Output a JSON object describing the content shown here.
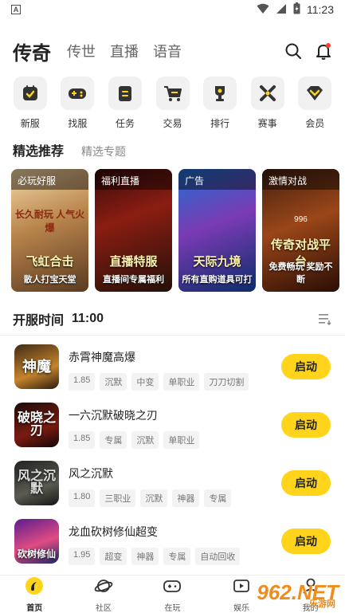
{
  "status_bar": {
    "time": "11:23",
    "app_indicator": "A"
  },
  "top_nav": {
    "tabs": [
      {
        "label": "传奇",
        "active": true
      },
      {
        "label": "传世",
        "active": false
      },
      {
        "label": "直播",
        "active": false
      },
      {
        "label": "语音",
        "active": false
      }
    ]
  },
  "quick_menu": [
    {
      "label": "新服",
      "icon": "calendar-check-icon"
    },
    {
      "label": "找服",
      "icon": "gamepad-icon"
    },
    {
      "label": "任务",
      "icon": "task-list-icon"
    },
    {
      "label": "交易",
      "icon": "cart-icon"
    },
    {
      "label": "排行",
      "icon": "trophy-icon"
    },
    {
      "label": "赛事",
      "icon": "crossed-swords-icon"
    },
    {
      "label": "会员",
      "icon": "vip-diamond-icon"
    }
  ],
  "section": {
    "title": "精选推荐",
    "subtitle": "精选专题"
  },
  "banners": [
    {
      "tag": "必玩好服",
      "big": "飞虹合击",
      "small": "散人打宝天堂",
      "top": "长久耐玩 人气火爆"
    },
    {
      "tag": "福利直播",
      "big": "直播特服",
      "small": "直播间专属福利",
      "top": ""
    },
    {
      "tag": "广告",
      "big": "天际九境",
      "small": "所有直购道具可打",
      "top": ""
    },
    {
      "tag": "激情对战",
      "big": "传奇对战平台",
      "small": "免费畅玩 奖励不断",
      "top": "996"
    }
  ],
  "open_time": {
    "label": "开服时间",
    "time": "11:00"
  },
  "servers": [
    {
      "thumb": "神魔",
      "title": "赤霄神魔高爆",
      "tags": [
        "1.85",
        "沉默",
        "中变",
        "单职业",
        "刀刀切割"
      ],
      "button": "启动"
    },
    {
      "thumb": "破晓之刃",
      "title": "一六沉默破晓之刃",
      "tags": [
        "1.85",
        "专属",
        "沉默",
        "单职业"
      ],
      "button": "启动"
    },
    {
      "thumb": "风之沉默",
      "title": "风之沉默",
      "tags": [
        "1.80",
        "三职业",
        "沉默",
        "神器",
        "专属"
      ],
      "button": "启动"
    },
    {
      "thumb": "砍树修仙",
      "title": "龙血砍树修仙超变",
      "tags": [
        "1.95",
        "超变",
        "神器",
        "专属",
        "自动回收"
      ],
      "button": "启动"
    }
  ],
  "bottom_nav": [
    {
      "label": "首页",
      "icon": "home-icon",
      "active": true
    },
    {
      "label": "社区",
      "icon": "planet-icon",
      "active": false
    },
    {
      "label": "在玩",
      "icon": "gamepad-icon",
      "active": false
    },
    {
      "label": "娱乐",
      "icon": "entertainment-icon",
      "active": false
    },
    {
      "label": "我的",
      "icon": "profile-icon",
      "active": false
    }
  ],
  "watermark": {
    "text": "962.NET",
    "sub": "乐游网"
  },
  "colors": {
    "accent": "#ffd41a",
    "active_text": "#222222",
    "inactive_text": "#666666"
  }
}
